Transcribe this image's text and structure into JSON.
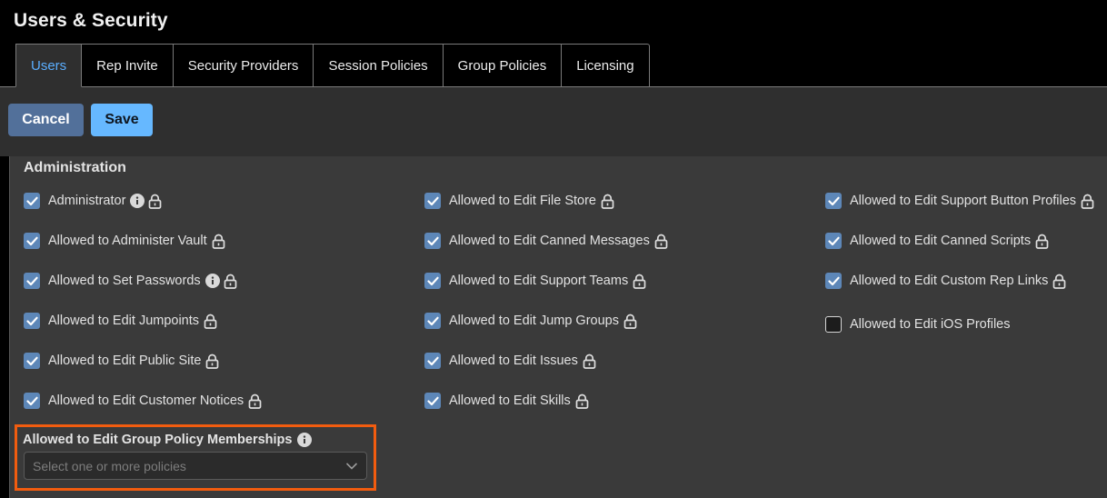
{
  "header": {
    "title": "Users & Security"
  },
  "tabs": [
    {
      "label": "Users",
      "active": true
    },
    {
      "label": "Rep Invite",
      "active": false
    },
    {
      "label": "Security Providers",
      "active": false
    },
    {
      "label": "Session Policies",
      "active": false
    },
    {
      "label": "Group Policies",
      "active": false
    },
    {
      "label": "Licensing",
      "active": false
    }
  ],
  "toolbar": {
    "cancel_label": "Cancel",
    "save_label": "Save"
  },
  "administration": {
    "title": "Administration",
    "columns": [
      [
        {
          "label": "Administrator",
          "checked": true,
          "info": true,
          "lock": true
        },
        {
          "label": "Allowed to Administer Vault",
          "checked": true,
          "info": false,
          "lock": true
        },
        {
          "label": "Allowed to Set Passwords",
          "checked": true,
          "info": true,
          "lock": true
        },
        {
          "label": "Allowed to Edit Jumpoints",
          "checked": true,
          "info": false,
          "lock": true
        },
        {
          "label": "Allowed to Edit Public Site",
          "checked": true,
          "info": false,
          "lock": true
        },
        {
          "label": "Allowed to Edit Customer Notices",
          "checked": true,
          "info": false,
          "lock": true
        }
      ],
      [
        {
          "label": "Allowed to Edit File Store",
          "checked": true,
          "info": false,
          "lock": true
        },
        {
          "label": "Allowed to Edit Canned Messages",
          "checked": true,
          "info": false,
          "lock": true
        },
        {
          "label": "Allowed to Edit Support Teams",
          "checked": true,
          "info": false,
          "lock": true
        },
        {
          "label": "Allowed to Edit Jump Groups",
          "checked": true,
          "info": false,
          "lock": true
        },
        {
          "label": "Allowed to Edit Issues",
          "checked": true,
          "info": false,
          "lock": true
        },
        {
          "label": "Allowed to Edit Skills",
          "checked": true,
          "info": false,
          "lock": true
        }
      ],
      [
        {
          "label": "Allowed to Edit Support Button Profiles",
          "checked": true,
          "info": false,
          "lock": true
        },
        {
          "label": "Allowed to Edit Canned Scripts",
          "checked": true,
          "info": false,
          "lock": true
        },
        {
          "label": "Allowed to Edit Custom Rep Links",
          "checked": true,
          "info": false,
          "lock": true
        },
        {
          "label": "Allowed to Edit iOS Profiles",
          "checked": false,
          "info": false,
          "lock": false
        }
      ]
    ],
    "group_policy_memberships": {
      "label": "Allowed to Edit Group Policy Memberships",
      "placeholder": "Select one or more policies"
    }
  },
  "colors": {
    "accent_blue": "#5aaeff",
    "save_button": "#66b8ff",
    "cancel_button": "#52709a",
    "checkbox_checked": "#5d87b8",
    "highlight": "#f25c0f"
  },
  "icons": {
    "info": "info-circle-icon",
    "lock": "lock-icon",
    "check": "check-icon",
    "dropdown": "chevron-down-icon"
  }
}
